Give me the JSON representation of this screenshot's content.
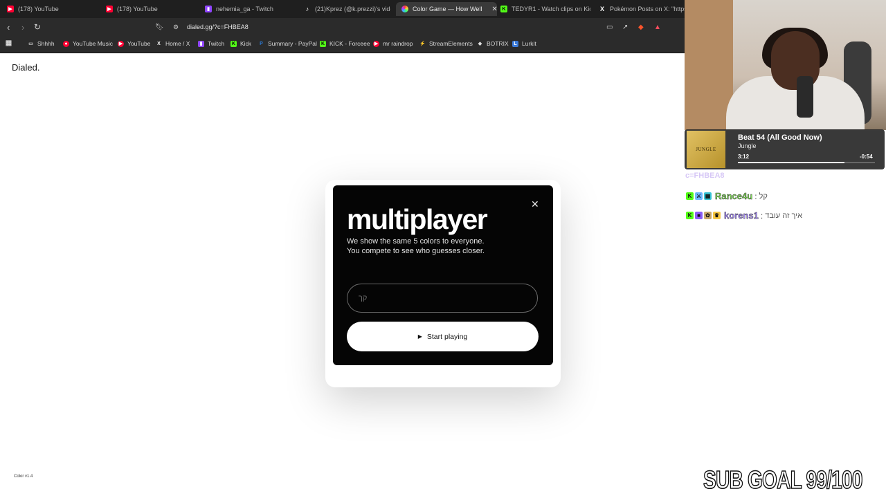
{
  "browser": {
    "tabs": [
      {
        "label": "(178) YouTube",
        "icon": "youtube-icon",
        "color": "#ff0033"
      },
      {
        "label": "(178) YouTube",
        "icon": "youtube-icon",
        "color": "#ff0033"
      },
      {
        "label": "nehemia_ga - Twitch",
        "icon": "twitch-icon",
        "color": "#9146ff"
      },
      {
        "label": "(21)Kprez (@k.prezzi)'s videos",
        "icon": "tiktok-icon",
        "color": "#ffffff"
      },
      {
        "label": "Color Game — How Well",
        "icon": "color-wheel-icon",
        "color": "#ff7a59",
        "active": true
      },
      {
        "label": "TEDYR1 - Watch clips on Kick",
        "icon": "kick-icon",
        "color": "#53fc18"
      },
      {
        "label": "Pokémon Posts on X: \"https://",
        "icon": "x-icon",
        "color": "#ffffff"
      }
    ],
    "tab_close": "✕",
    "url": "dialed.gg/?c=FHBEA8",
    "bookmarks": [
      {
        "label": "Shhhh",
        "icon": "folder-icon",
        "color": "#cfcfcf"
      },
      {
        "label": "YouTube Music",
        "icon": "youtube-music-icon",
        "color": "#ff0033"
      },
      {
        "label": "YouTube",
        "icon": "youtube-icon",
        "color": "#ff0033"
      },
      {
        "label": "Home / X",
        "icon": "x-icon",
        "color": "#ffffff"
      },
      {
        "label": "Twitch",
        "icon": "twitch-icon",
        "color": "#9146ff"
      },
      {
        "label": "Kick",
        "icon": "kick-icon",
        "color": "#53fc18"
      },
      {
        "label": "Summary - PayPal",
        "icon": "paypal-icon",
        "color": "#2a7bd9"
      },
      {
        "label": "KICK - Forceee",
        "icon": "kick-icon",
        "color": "#53fc18"
      },
      {
        "label": "mr raindrop",
        "icon": "youtube-icon",
        "color": "#ff0033"
      },
      {
        "label": "StreamElements",
        "icon": "streamelements-icon",
        "color": "#cfcfcf"
      },
      {
        "label": "BOTRIX",
        "icon": "botrix-icon",
        "color": "#cfcfcf"
      },
      {
        "label": "Lurkit",
        "icon": "lurkit-icon",
        "color": "#3d7bd9"
      }
    ]
  },
  "page": {
    "brand": "Dialed.",
    "version": "Color v1.4",
    "modal": {
      "title": "multiplayer",
      "line1": "We show the same 5 colors to everyone.",
      "line2": "You compete to see who guesses closer.",
      "name_value": "",
      "name_placeholder": "קך",
      "start_label": "Start playing",
      "close": "✕"
    }
  },
  "overlay": {
    "now_playing": {
      "art_text": "JUNGLE",
      "title": "Beat 54 (All Good Now)",
      "artist": "Jungle",
      "elapsed": "3:12",
      "remaining": "-0:54",
      "progress": 0.78
    },
    "chat_top": "c=FHBEA8",
    "chat": [
      {
        "user": "Rance4u",
        "user_color": "#7ed957",
        "message": "קל",
        "badges": [
          "kick-icon",
          "sword-icon",
          "grid-icon"
        ]
      },
      {
        "user": "korens1",
        "user_color": "#a78bfa",
        "message": "איך זה עובד",
        "badges": [
          "kick-icon",
          "cube-icon",
          "gift-icon",
          "crown-icon"
        ]
      }
    ],
    "sub_goal": "SUB GOAL 99/100"
  }
}
